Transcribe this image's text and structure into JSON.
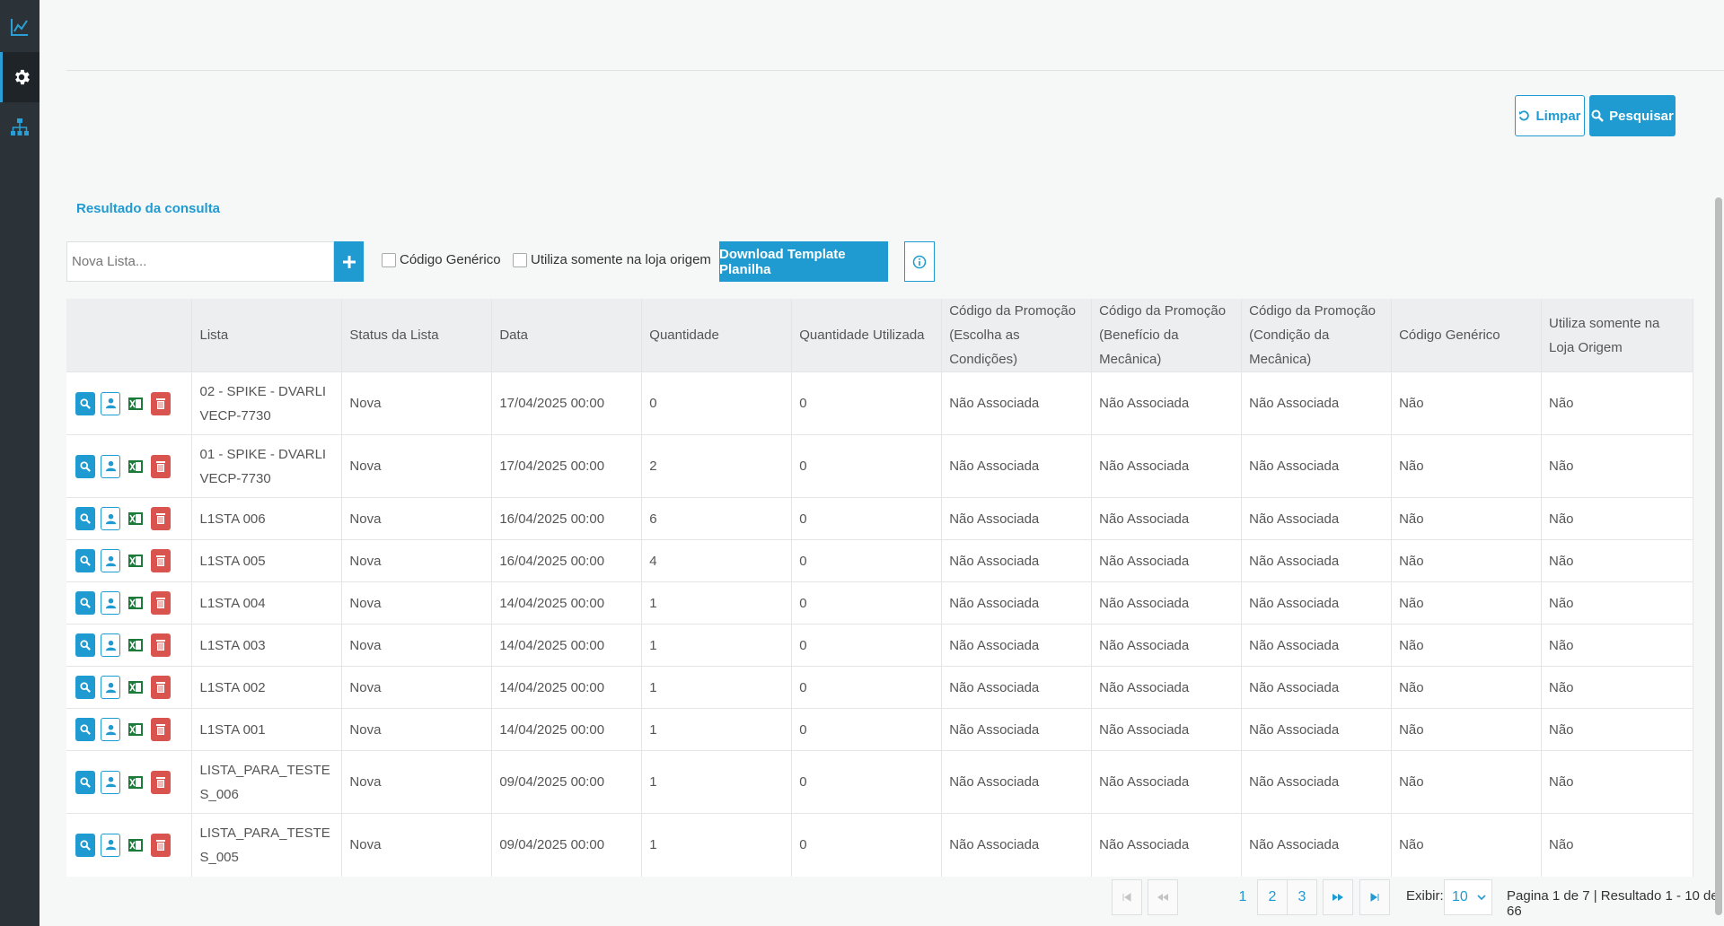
{
  "sidebar": {
    "items": [
      {
        "icon": "chart-icon"
      },
      {
        "icon": "gear-icon",
        "active": true
      },
      {
        "icon": "sitemap-icon"
      }
    ]
  },
  "filters": {
    "clear_label": "Limpar",
    "search_label": "Pesquisar"
  },
  "results": {
    "title": "Resultado da consulta",
    "new_list_placeholder": "Nova Lista...",
    "chk_generic": "Código Genérico",
    "chk_origin_store": "Utiliza somente na loja origem",
    "download_label": "Download Template Planilha"
  },
  "table": {
    "headers": [
      "",
      "Lista",
      "Status da Lista",
      "Data",
      "Quantidade",
      "Quantidade Utilizada",
      "Código da Promoção (Escolha as Condições)",
      "Código da Promoção (Benefício da Mecânica)",
      "Código da Promoção (Condição da Mecânica)",
      "Código Genérico",
      "Utiliza somente na Loja Origem"
    ],
    "rows": [
      [
        "02 - SPIKE - DVARLIVECP-7730",
        "Nova",
        "17/04/2025 00:00",
        "0",
        "0",
        "Não Associada",
        "Não Associada",
        "Não Associada",
        "Não",
        "Não"
      ],
      [
        "01 - SPIKE - DVARLIVECP-7730",
        "Nova",
        "17/04/2025 00:00",
        "2",
        "0",
        "Não Associada",
        "Não Associada",
        "Não Associada",
        "Não",
        "Não"
      ],
      [
        "L1STA 006",
        "Nova",
        "16/04/2025 00:00",
        "6",
        "0",
        "Não Associada",
        "Não Associada",
        "Não Associada",
        "Não",
        "Não"
      ],
      [
        "L1STA 005",
        "Nova",
        "16/04/2025 00:00",
        "4",
        "0",
        "Não Associada",
        "Não Associada",
        "Não Associada",
        "Não",
        "Não"
      ],
      [
        "L1STA 004",
        "Nova",
        "14/04/2025 00:00",
        "1",
        "0",
        "Não Associada",
        "Não Associada",
        "Não Associada",
        "Não",
        "Não"
      ],
      [
        "L1STA 003",
        "Nova",
        "14/04/2025 00:00",
        "1",
        "0",
        "Não Associada",
        "Não Associada",
        "Não Associada",
        "Não",
        "Não"
      ],
      [
        "L1STA 002",
        "Nova",
        "14/04/2025 00:00",
        "1",
        "0",
        "Não Associada",
        "Não Associada",
        "Não Associada",
        "Não",
        "Não"
      ],
      [
        "L1STA 001",
        "Nova",
        "14/04/2025 00:00",
        "1",
        "0",
        "Não Associada",
        "Não Associada",
        "Não Associada",
        "Não",
        "Não"
      ],
      [
        "LISTA_PARA_TESTES_006",
        "Nova",
        "09/04/2025 00:00",
        "1",
        "0",
        "Não Associada",
        "Não Associada",
        "Não Associada",
        "Não",
        "Não"
      ],
      [
        "LISTA_PARA_TESTES_005",
        "Nova",
        "09/04/2025 00:00",
        "1",
        "0",
        "Não Associada",
        "Não Associada",
        "Não Associada",
        "Não",
        "Não"
      ]
    ]
  },
  "pagination": {
    "pages": [
      "1",
      "2",
      "3"
    ],
    "show_label": "Exibir:",
    "page_size": "10",
    "info": "Pagina 1 de 7 | Resultado 1 - 10 de 66"
  },
  "colors": {
    "accent": "#1f9bd1",
    "danger": "#d9534f",
    "excel": "#1d7a3a",
    "sidebar": "#2b3338"
  }
}
